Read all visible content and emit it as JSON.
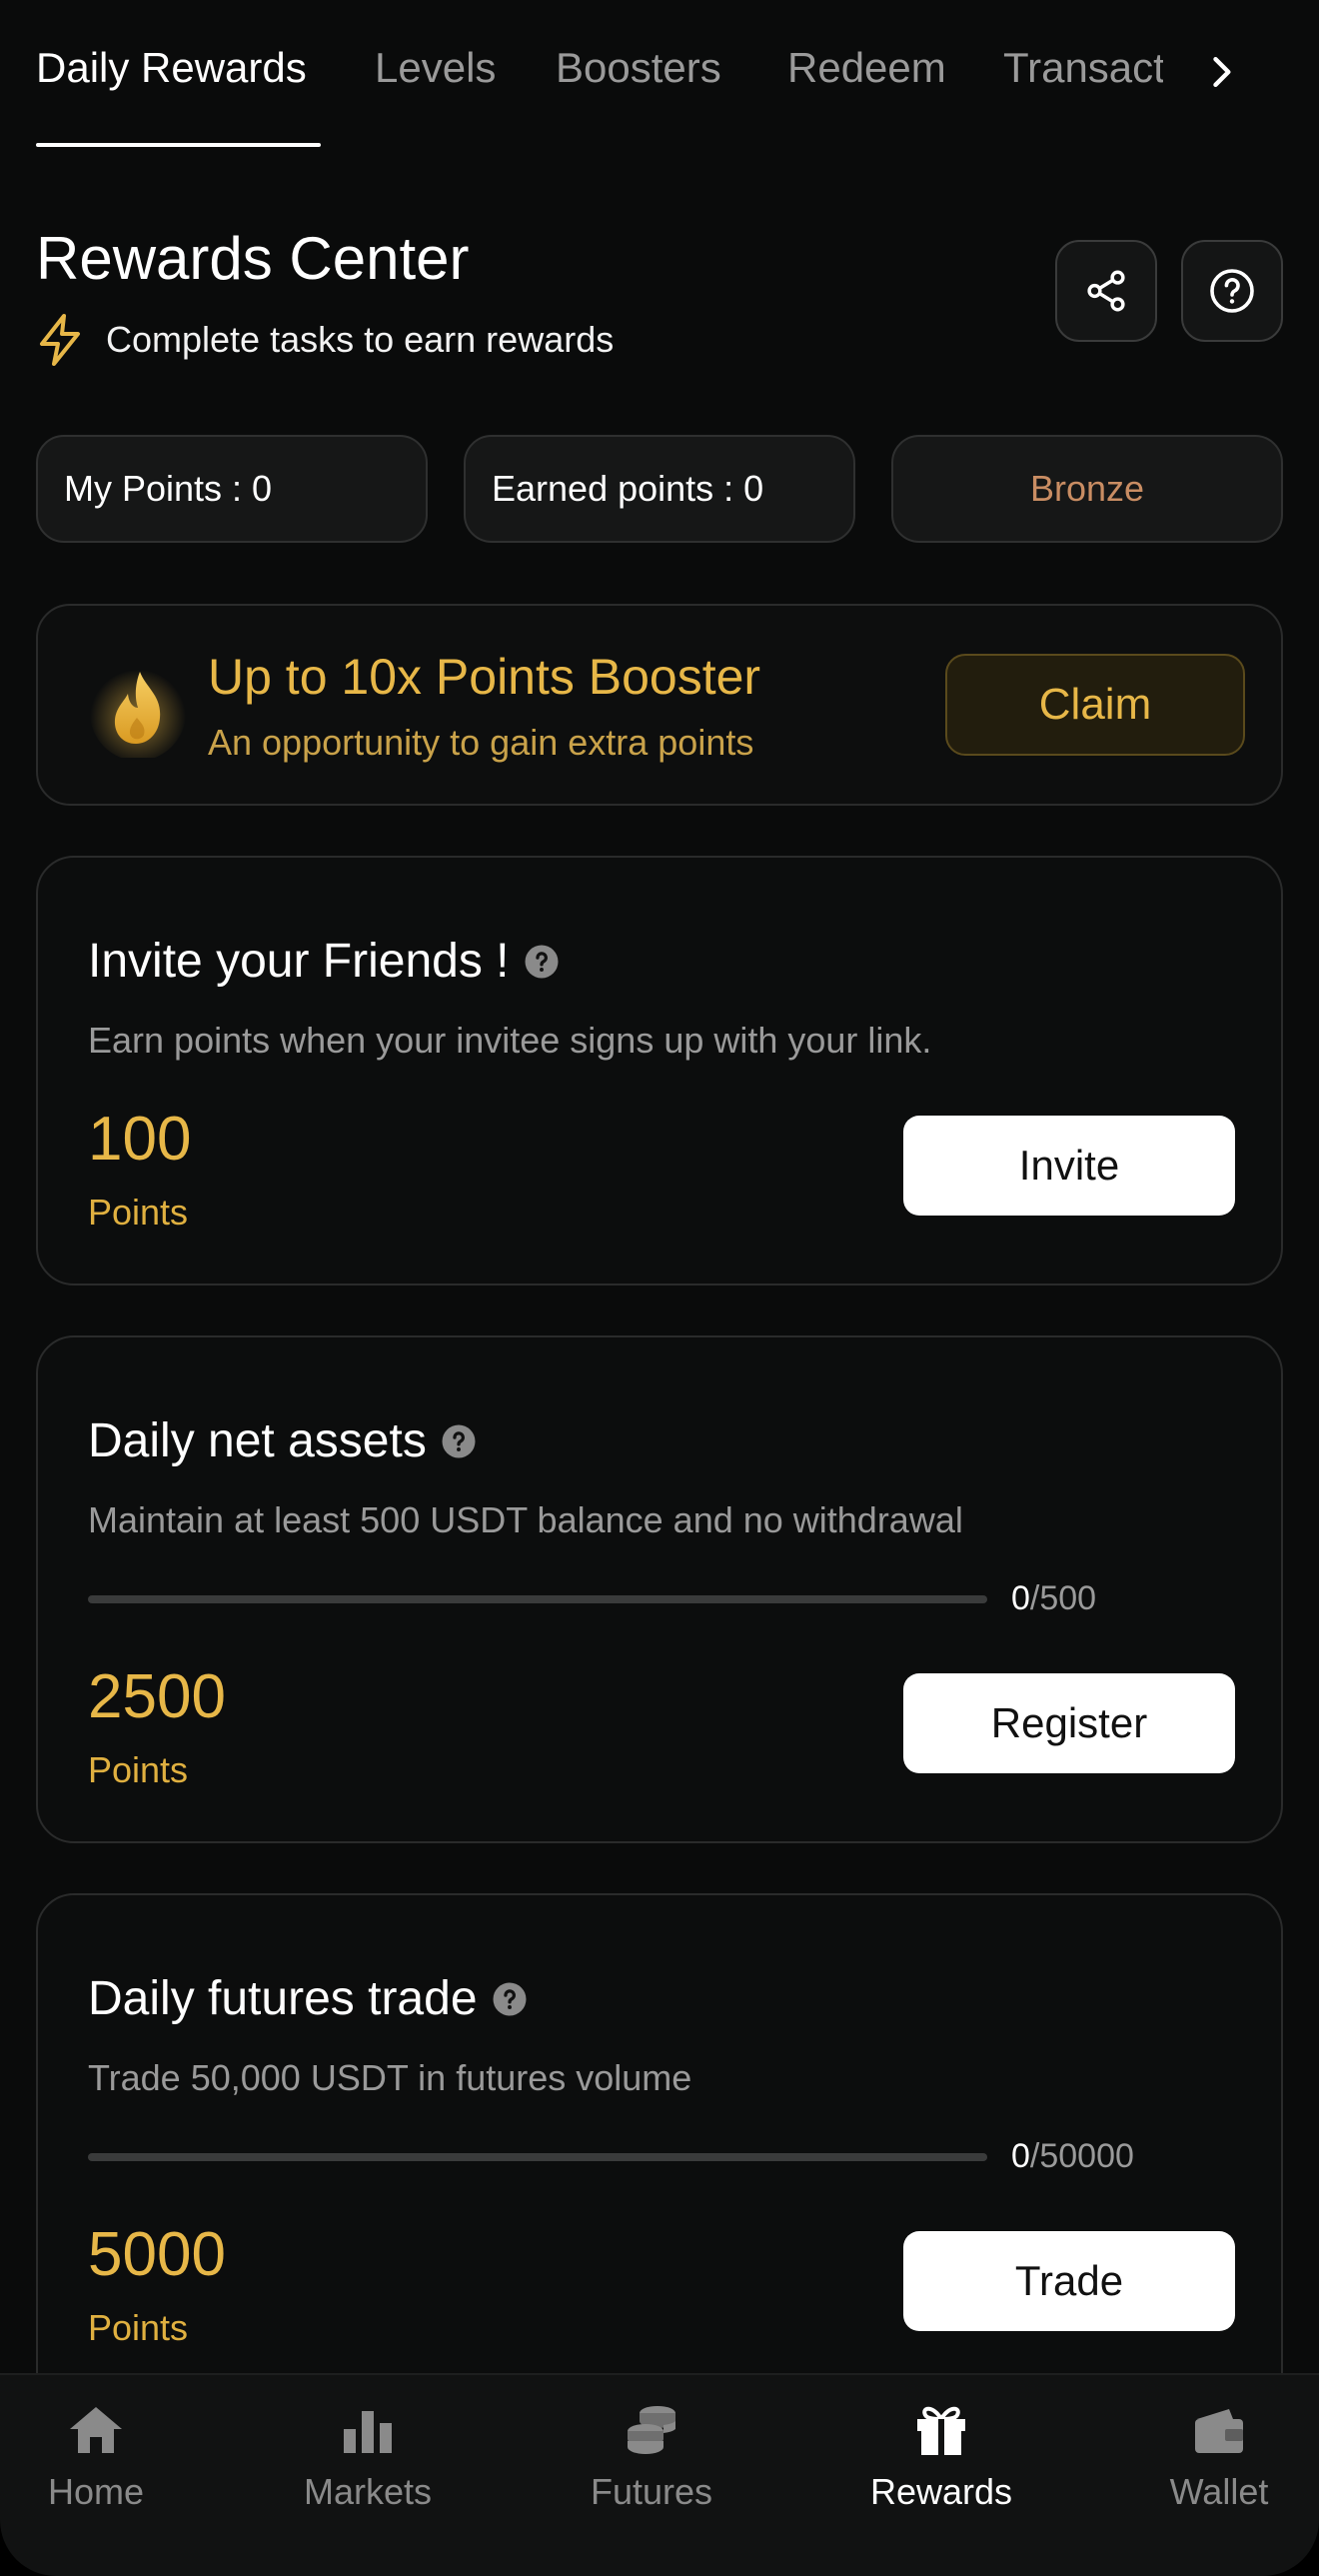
{
  "tabs": [
    {
      "label": "Daily Rewards",
      "active": true
    },
    {
      "label": "Levels",
      "active": false
    },
    {
      "label": "Boosters",
      "active": false
    },
    {
      "label": "Redeem",
      "active": false
    },
    {
      "label": "Transact",
      "active": false
    }
  ],
  "header": {
    "title": "Rewards Center",
    "subtitle": "Complete tasks to earn rewards",
    "icons": [
      "lightning-icon",
      "share-icon",
      "help-icon"
    ]
  },
  "stats": {
    "my_points": "My Points : 0",
    "earned_points": "Earned points : 0",
    "tier": "Bronze"
  },
  "booster": {
    "title": "Up to 10x Points Booster",
    "subtitle": "An opportunity to gain extra points",
    "button": "Claim"
  },
  "tasks": [
    {
      "title": "Invite your Friends !",
      "description": "Earn points when your invitee signs up with your link.",
      "points": "100",
      "points_label": "Points",
      "button": "Invite"
    },
    {
      "title": "Daily net assets",
      "description": "Maintain at least 500 USDT balance and no withdrawal",
      "progress_current": "0",
      "progress_total": "/500",
      "progress_fraction": 0,
      "points": "2500",
      "points_label": "Points",
      "button": "Register"
    },
    {
      "title": "Daily futures trade",
      "description": "Trade 50,000 USDT in futures volume",
      "progress_current": "0",
      "progress_total": "/50000",
      "progress_fraction": 0,
      "points": "5000",
      "points_label": "Points",
      "button": "Trade"
    }
  ],
  "nav": [
    {
      "label": "Home",
      "icon": "home-icon",
      "active": false
    },
    {
      "label": "Markets",
      "icon": "bar-chart-icon",
      "active": false
    },
    {
      "label": "Futures",
      "icon": "coins-icon",
      "active": false
    },
    {
      "label": "Rewards",
      "icon": "gift-icon",
      "active": true
    },
    {
      "label": "Wallet",
      "icon": "wallet-icon",
      "active": false
    }
  ],
  "colors": {
    "background": "#0a0b0b",
    "accent_gold": "#e7b748",
    "bronze": "#c98d63",
    "muted_text": "#9a9a9a"
  }
}
